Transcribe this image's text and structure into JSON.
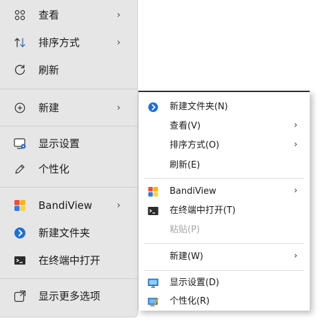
{
  "primary_menu": {
    "items": [
      {
        "label": "查看",
        "icon": "grid-view-icon",
        "submenu": true
      },
      {
        "label": "排序方式",
        "icon": "sort-arrows-icon",
        "submenu": true
      },
      {
        "label": "刷新",
        "icon": "refresh-icon",
        "submenu": false
      },
      {
        "label": "新建",
        "icon": "new-plus-icon",
        "submenu": true
      },
      {
        "label": "显示设置",
        "icon": "display-settings-icon",
        "submenu": false
      },
      {
        "label": "个性化",
        "icon": "pen-brush-icon",
        "submenu": false
      },
      {
        "label": "BandiView",
        "icon": "bandiview-logo-icon",
        "submenu": true
      },
      {
        "label": "新建文件夹",
        "icon": "new-folder-blue-icon",
        "submenu": false
      },
      {
        "label": "在终端中打开",
        "icon": "terminal-icon",
        "submenu": false
      },
      {
        "label": "显示更多选项",
        "icon": "more-options-icon",
        "submenu": false
      }
    ],
    "arrow": "›"
  },
  "secondary_menu": {
    "items": [
      {
        "label": "新建文件夹(N)",
        "icon": "new-folder-blue-icon",
        "submenu": false,
        "disabled": false
      },
      {
        "label": "查看(V)",
        "icon": "",
        "submenu": true,
        "disabled": false
      },
      {
        "label": "排序方式(O)",
        "icon": "",
        "submenu": true,
        "disabled": false
      },
      {
        "label": "刷新(E)",
        "icon": "",
        "submenu": false,
        "disabled": false
      },
      {
        "label": "BandiView",
        "icon": "bandiview-logo-icon",
        "submenu": true,
        "disabled": false
      },
      {
        "label": "在终端中打开(T)",
        "icon": "terminal-icon",
        "submenu": false,
        "disabled": false
      },
      {
        "label": "粘贴(P)",
        "icon": "",
        "submenu": false,
        "disabled": true
      },
      {
        "label": "新建(W)",
        "icon": "",
        "submenu": true,
        "disabled": false
      },
      {
        "label": "显示设置(D)",
        "icon": "monitor-icon",
        "submenu": false,
        "disabled": false
      },
      {
        "label": "个性化(R)",
        "icon": "personalize-icon",
        "submenu": false,
        "disabled": false
      }
    ],
    "arrow": "›"
  },
  "colors": {
    "primary_bg": "#e6e6e6",
    "accent_blue": "#1f6fd6",
    "disabled_text": "#a6a6a6"
  }
}
